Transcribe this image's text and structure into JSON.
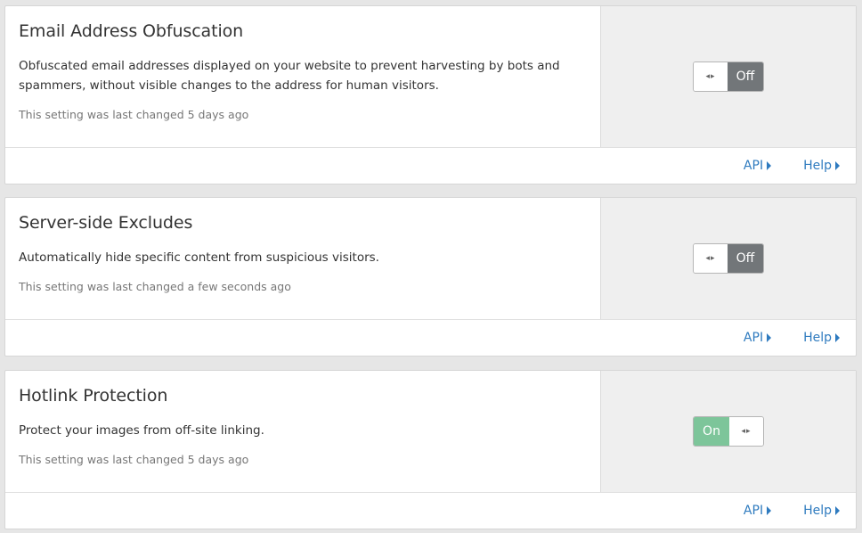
{
  "cards": [
    {
      "title": "Email Address Obfuscation",
      "description": "Obfuscated email addresses displayed on your website to prevent harvesting by bots and spammers, without visible changes to the address for human visitors.",
      "last_changed": "This setting was last changed 5 days ago",
      "toggle": {
        "state": "Off",
        "handle_icon": "◂▸"
      },
      "links": {
        "api": "API",
        "help": "Help"
      }
    },
    {
      "title": "Server-side Excludes",
      "description": "Automatically hide specific content from suspicious visitors.",
      "last_changed": "This setting was last changed a few seconds ago",
      "toggle": {
        "state": "Off",
        "handle_icon": "◂▸"
      },
      "links": {
        "api": "API",
        "help": "Help"
      }
    },
    {
      "title": "Hotlink Protection",
      "description": "Protect your images from off-site linking.",
      "last_changed": "This setting was last changed 5 days ago",
      "toggle": {
        "state": "On",
        "handle_icon": "◂▸"
      },
      "links": {
        "api": "API",
        "help": "Help"
      }
    }
  ],
  "colors": {
    "on": "#7dc59a",
    "off": "#727679",
    "link": "#2f7bbf"
  }
}
